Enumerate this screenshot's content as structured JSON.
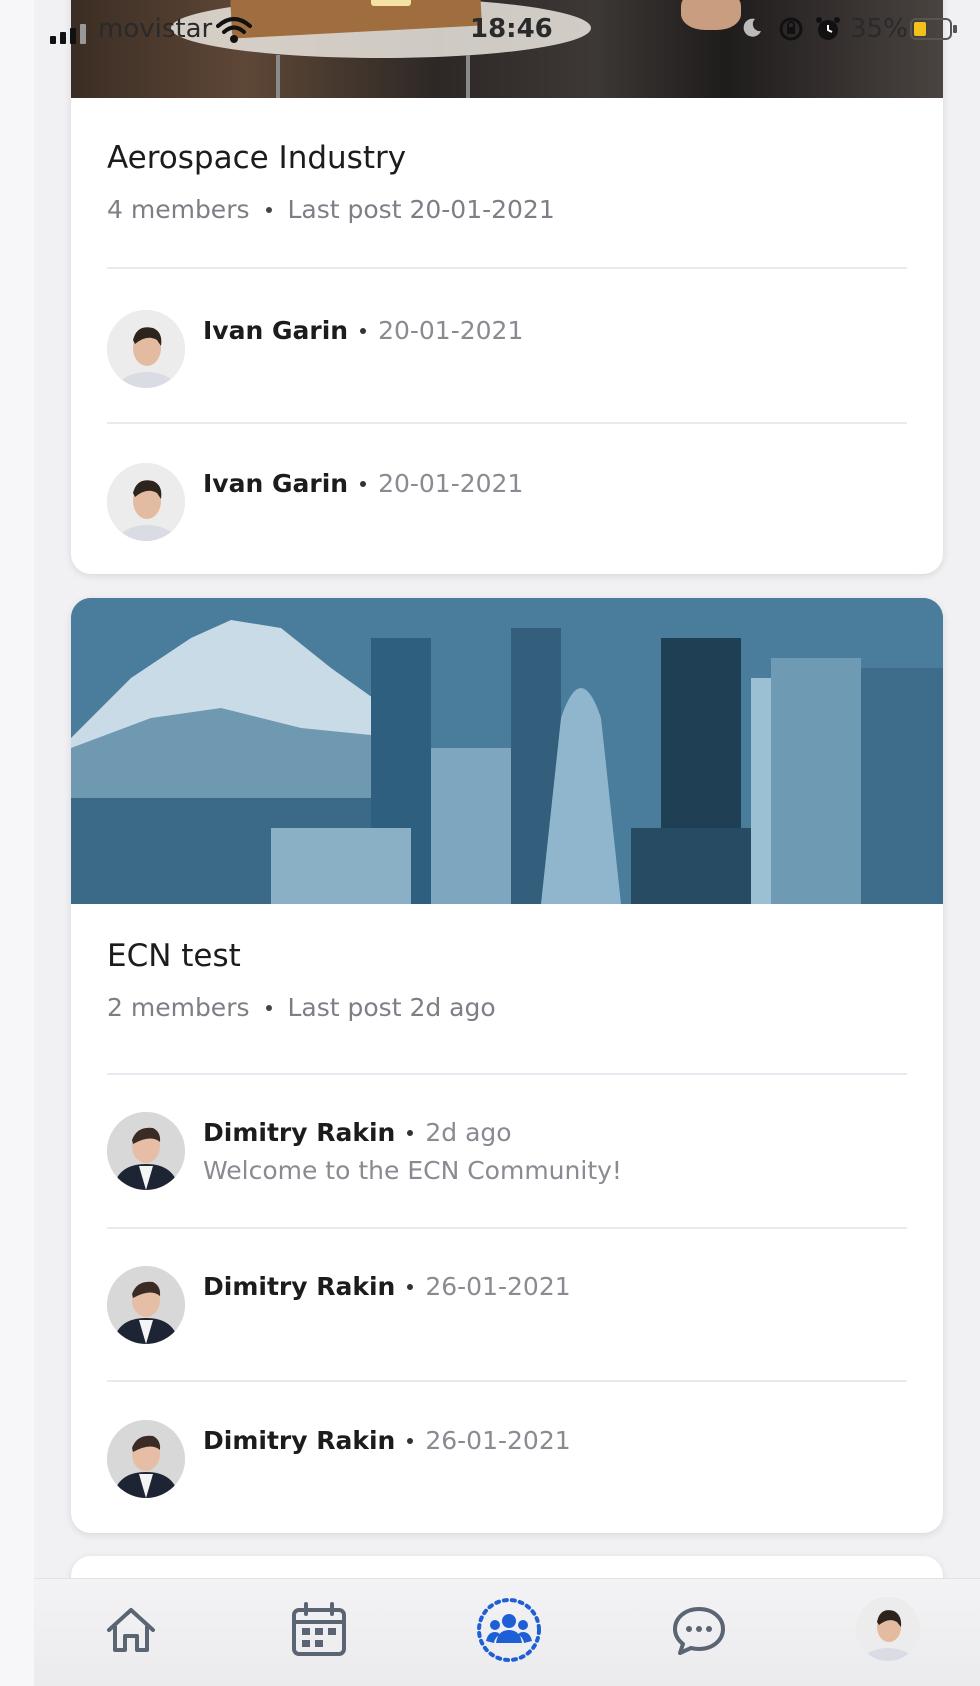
{
  "status_bar": {
    "carrier": "movistar",
    "time": "18:46",
    "battery_percent": "35%",
    "battery_level": 0.35
  },
  "groups": [
    {
      "name": "Aerospace Industry",
      "members": "4 members",
      "last_post": "Last post 20-01-2021",
      "posts": [
        {
          "author": "Ivan Garin",
          "date": "20-01-2021",
          "text": ""
        },
        {
          "author": "Ivan Garin",
          "date": "20-01-2021",
          "text": ""
        }
      ]
    },
    {
      "name": "ECN test",
      "members": "2 members",
      "last_post": "Last post 2d ago",
      "posts": [
        {
          "author": "Dimitry Rakin",
          "date": "2d ago",
          "text": "Welcome to the ECN Community!"
        },
        {
          "author": "Dimitry Rakin",
          "date": "26-01-2021",
          "text": ""
        },
        {
          "author": "Dimitry Rakin",
          "date": "26-01-2021",
          "text": ""
        }
      ]
    }
  ],
  "bottom_nav": {
    "items": [
      {
        "icon": "home-icon",
        "active": false
      },
      {
        "icon": "calendar-icon",
        "active": false
      },
      {
        "icon": "community-icon",
        "active": true
      },
      {
        "icon": "chat-icon",
        "active": false
      },
      {
        "icon": "profile-avatar",
        "active": false
      }
    ],
    "active_color": "#1f5fd6",
    "inactive_color": "#5b6472"
  }
}
